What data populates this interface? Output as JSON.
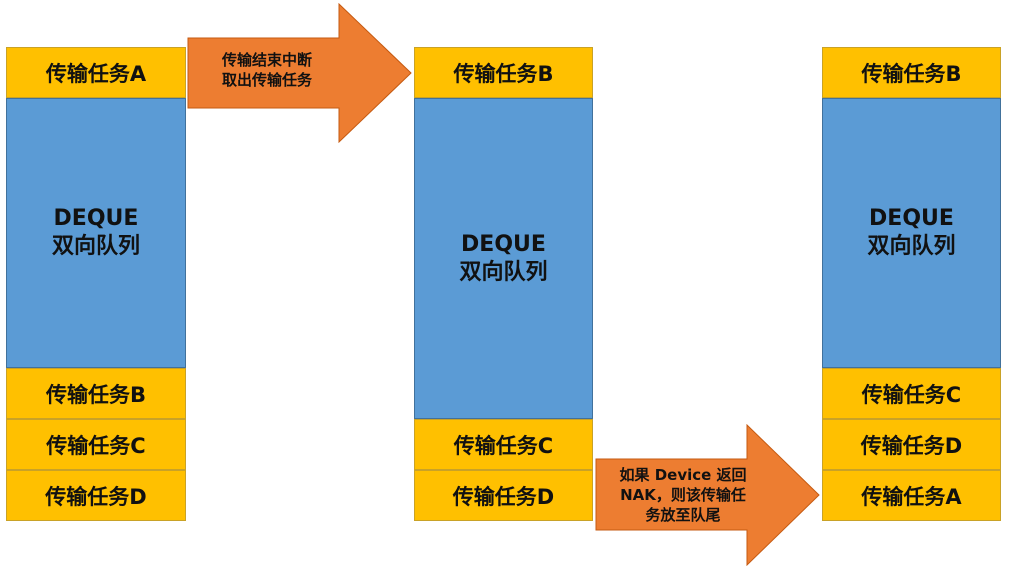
{
  "columns": [
    {
      "top": [
        "传输任务A"
      ],
      "deque_line1": "DEQUE",
      "deque_line2": "双向队列",
      "bottom": [
        "传输任务B",
        "传输任务C",
        "传输任务D"
      ]
    },
    {
      "top": [
        "传输任务B"
      ],
      "deque_line1": "DEQUE",
      "deque_line2": "双向队列",
      "bottom": [
        "传输任务C",
        "传输任务D"
      ]
    },
    {
      "top": [
        "传输任务B"
      ],
      "deque_line1": "DEQUE",
      "deque_line2": "双向队列",
      "bottom": [
        "传输任务C",
        "传输任务D",
        "传输任务A"
      ]
    }
  ],
  "arrows": [
    {
      "line1": "传输结束中断",
      "line2": "取出传输任务"
    },
    {
      "line1": "如果 Device 返回",
      "line2": "NAK，则该传输任",
      "line3": "务放至队尾"
    }
  ],
  "colors": {
    "task": "#FFC000",
    "deque": "#5B9BD5",
    "arrow": "#ED7D31"
  }
}
